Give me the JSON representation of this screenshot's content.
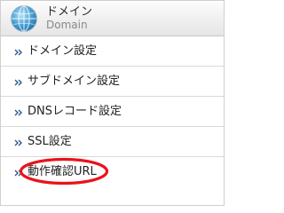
{
  "header": {
    "title": "ドメイン",
    "subtitle": "Domain",
    "icon": "globe-icon"
  },
  "menu": {
    "items": [
      {
        "label": "ドメイン設定",
        "icon": "chevron-right-icon"
      },
      {
        "label": "サブドメイン設定",
        "icon": "chevron-right-icon"
      },
      {
        "label": "DNSレコード設定",
        "icon": "chevron-right-icon"
      },
      {
        "label": "SSL設定",
        "icon": "chevron-right-icon"
      },
      {
        "label": "動作確認URL",
        "icon": "chevron-right-icon",
        "highlighted": true
      }
    ]
  },
  "colors": {
    "highlight": "#e8141c",
    "globe": "#3a8fc4",
    "bullet": "#2a5a8a"
  }
}
